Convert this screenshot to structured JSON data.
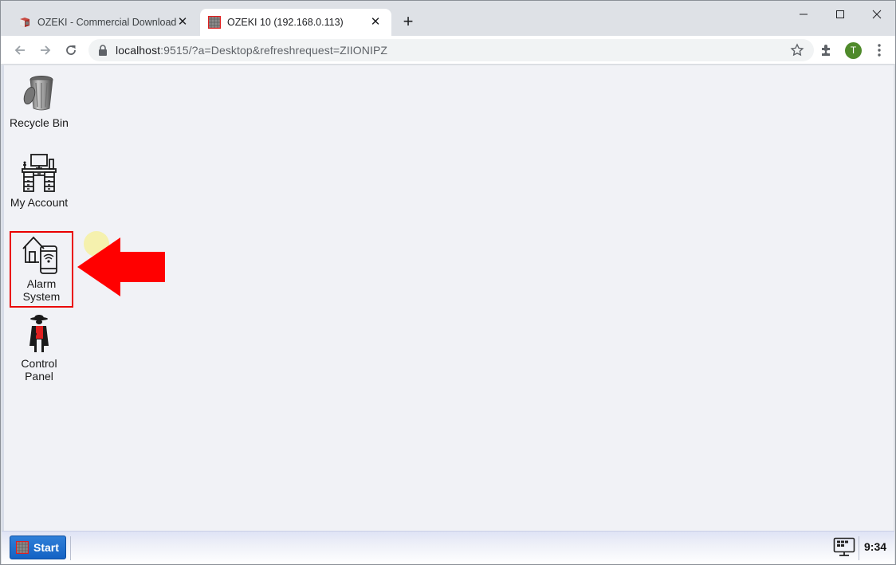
{
  "browser": {
    "tabs": [
      {
        "title": "OZEKI - Commercial Download",
        "active": false,
        "icon": "ozeki-box-icon"
      },
      {
        "title": "OZEKI 10 (192.168.0.113)",
        "active": true,
        "icon": "ozeki-grid-icon"
      }
    ],
    "new_tab_label": "+",
    "address": {
      "host": "localhost",
      "path": ":9515/?a=Desktop&refreshrequest=ZIIONIPZ"
    },
    "profile_initial": "T",
    "profile_color": "#4f8a2b"
  },
  "desktop": {
    "icons": [
      {
        "label": "Recycle Bin",
        "icon": "recycle-bin-icon"
      },
      {
        "label": "My Account",
        "icon": "desk-computer-icon"
      },
      {
        "label": "Alarm System",
        "icon": "house-phone-wifi-icon",
        "highlighted": true
      },
      {
        "label": "Control Panel",
        "icon": "agent-figure-icon"
      }
    ],
    "annotation": {
      "type": "arrow",
      "color": "#ff0000",
      "points_to": "Alarm System"
    }
  },
  "taskbar": {
    "start_label": "Start",
    "clock": "9:34",
    "accent": "#1a6ccf"
  }
}
